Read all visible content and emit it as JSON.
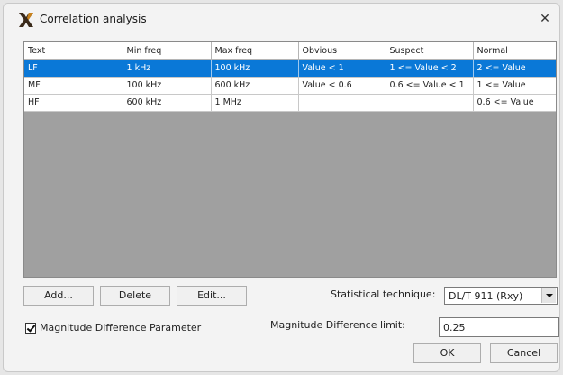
{
  "window": {
    "title": "Correlation analysis",
    "close_glyph": "✕"
  },
  "table": {
    "columns": [
      "Text",
      "Min freq",
      "Max freq",
      "Obvious",
      "Suspect",
      "Normal"
    ],
    "rows": [
      {
        "cells": [
          "LF",
          "1 kHz",
          "100 kHz",
          "Value < 1",
          "1 <= Value < 2",
          "2 <= Value"
        ],
        "selected": true
      },
      {
        "cells": [
          "MF",
          "100 kHz",
          "600 kHz",
          "Value < 0.6",
          "0.6 <= Value < 1",
          "1 <= Value"
        ],
        "selected": false
      },
      {
        "cells": [
          "HF",
          "600 kHz",
          "1 MHz",
          "",
          "",
          "0.6 <= Value"
        ],
        "selected": false
      }
    ]
  },
  "buttons": {
    "add": "Add...",
    "delete": "Delete",
    "edit": "Edit...",
    "ok": "OK",
    "cancel": "Cancel"
  },
  "statistical_technique": {
    "label": "Statistical technique:",
    "value": "DL/T 911 (Rxy)"
  },
  "magnitude_parameter": {
    "label": "Magnitude Difference Parameter",
    "checked": true
  },
  "magnitude_limit": {
    "label": "Magnitude Difference limit:",
    "value": "0.25"
  },
  "colors": {
    "selection": "#0a78d7",
    "grid_background": "#a0a0a0",
    "dialog_background": "#f3f3f3"
  }
}
